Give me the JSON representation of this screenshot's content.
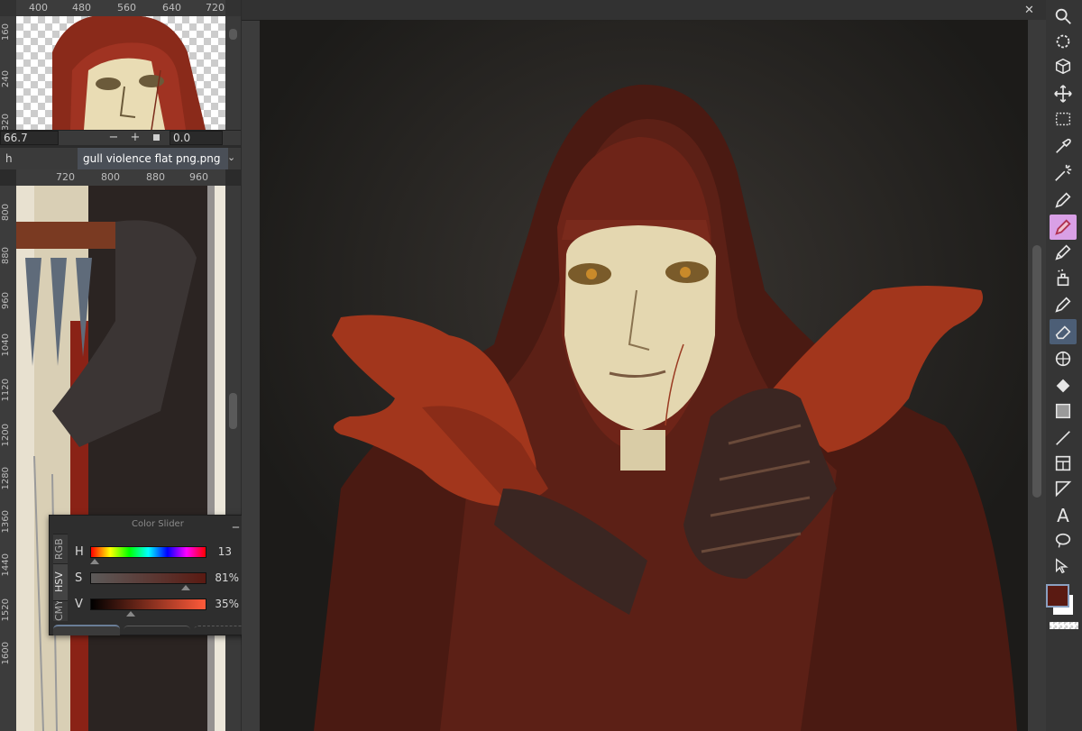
{
  "navigator": {
    "ruler_h": [
      "400",
      "480",
      "560",
      "640",
      "720"
    ],
    "ruler_v": [
      "160",
      "240",
      "320"
    ],
    "zoom_value": "66.7",
    "minus": "−",
    "plus": "+",
    "angle_value": "0.0"
  },
  "subview": {
    "tab_left_partial": "h",
    "tab_active": "gull violence flat png.png",
    "ruler_h": [
      "720",
      "800",
      "880",
      "960"
    ],
    "ruler_v": [
      "800",
      "880",
      "960",
      "1040",
      "1120",
      "1200",
      "1280",
      "1360",
      "1440",
      "1520",
      "1600"
    ]
  },
  "color_slider": {
    "title": "Color Slider",
    "modes": [
      "RGB",
      "HSV",
      "CMY"
    ],
    "active_mode": "HSV",
    "sliders": [
      {
        "label": "H",
        "value": "13",
        "fraction": 0.04
      },
      {
        "label": "S",
        "value": "81%",
        "fraction": 0.81
      },
      {
        "label": "V",
        "value": "35%",
        "fraction": 0.35
      }
    ]
  },
  "colors": {
    "foreground": "#5a1a12",
    "background": "#ffffff",
    "accent": "#4c5e76"
  },
  "tools": [
    {
      "name": "zoom-icon",
      "glyph": "🔍"
    },
    {
      "name": "rotate-view-icon",
      "glyph": "⟳"
    },
    {
      "name": "3d-transform-icon",
      "glyph": "⬡"
    },
    {
      "name": "move-icon",
      "glyph": "✥"
    },
    {
      "name": "rect-select-icon",
      "glyph": "⬚"
    },
    {
      "name": "eyedropper-icon",
      "glyph": "✎"
    },
    {
      "name": "magic-wand-icon",
      "glyph": "✷"
    },
    {
      "name": "pen-icon",
      "glyph": "✒"
    },
    {
      "name": "brush-preset-icon",
      "glyph": "✐"
    },
    {
      "name": "pencil-icon",
      "glyph": "✏"
    },
    {
      "name": "airbrush-icon",
      "glyph": "♨"
    },
    {
      "name": "decoration-icon",
      "glyph": "✑"
    },
    {
      "name": "eraser-icon",
      "glyph": "⌫"
    },
    {
      "name": "blend-icon",
      "glyph": "◍"
    },
    {
      "name": "fill-icon",
      "glyph": "◈"
    },
    {
      "name": "gradient-icon",
      "glyph": "◧"
    },
    {
      "name": "line-icon",
      "glyph": "╱"
    },
    {
      "name": "frame-icon",
      "glyph": "▦"
    },
    {
      "name": "ruler-icon",
      "glyph": "◸"
    },
    {
      "name": "text-icon",
      "glyph": "A"
    },
    {
      "name": "lasso-icon",
      "glyph": "◯"
    },
    {
      "name": "object-select-icon",
      "glyph": "↖"
    }
  ]
}
